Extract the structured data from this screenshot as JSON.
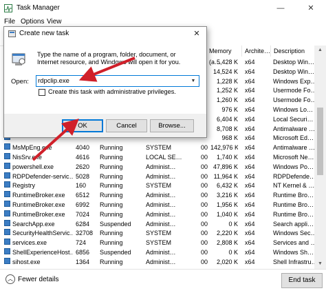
{
  "window": {
    "title": "Task Manager",
    "minimize": "—",
    "close": "✕"
  },
  "menu": [
    "File",
    "Options",
    "View"
  ],
  "columns": {
    "memory": "Memory (a…",
    "arch": "Archite…",
    "description": "Description"
  },
  "rows": [
    {
      "name": "",
      "pid": "",
      "status": "",
      "user": "",
      "cpu": "",
      "mem": "5,428 K",
      "arch": "x64",
      "desc": "Desktop Win…"
    },
    {
      "name": "",
      "pid": "",
      "status": "",
      "user": "",
      "cpu": "",
      "mem": "14,524 K",
      "arch": "x64",
      "desc": "Desktop Win…"
    },
    {
      "name": "",
      "pid": "",
      "status": "",
      "user": "",
      "cpu": "",
      "mem": "1,228 K",
      "arch": "x64",
      "desc": "Windows Exp…"
    },
    {
      "name": "",
      "pid": "",
      "status": "",
      "user": "",
      "cpu": "",
      "mem": "1,252 K",
      "arch": "x64",
      "desc": "Usermode Fo…"
    },
    {
      "name": "",
      "pid": "",
      "status": "",
      "user": "",
      "cpu": "",
      "mem": "1,260 K",
      "arch": "x64",
      "desc": "Usermode Fo…"
    },
    {
      "name": "",
      "pid": "",
      "status": "",
      "user": "",
      "cpu": "",
      "mem": "976 K",
      "arch": "x64",
      "desc": "Windows Lo…"
    },
    {
      "name": "",
      "pid": "",
      "status": "",
      "user": "",
      "cpu": "",
      "mem": "6,404 K",
      "arch": "x64",
      "desc": "Local Securi…"
    },
    {
      "name": "",
      "pid": "",
      "status": "",
      "user": "",
      "cpu": "",
      "mem": "8,708 K",
      "arch": "x64",
      "desc": "Antimalware …"
    },
    {
      "name": "",
      "pid": "",
      "status": "",
      "user": "",
      "cpu": "",
      "mem": "968 K",
      "arch": "x64",
      "desc": "Microsoft Ed…"
    },
    {
      "name": "MsMpEng.exe",
      "pid": "4040",
      "status": "Running",
      "user": "SYSTEM",
      "cpu": "00",
      "mem": "142,976 K",
      "arch": "x64",
      "desc": "Antimalware …"
    },
    {
      "name": "NisSrv.exe",
      "pid": "4616",
      "status": "Running",
      "user": "LOCAL SE…",
      "cpu": "00",
      "mem": "1,740 K",
      "arch": "x64",
      "desc": "Microsoft Ne…"
    },
    {
      "name": "powershell.exe",
      "pid": "2620",
      "status": "Running",
      "user": "Administ…",
      "cpu": "00",
      "mem": "47,896 K",
      "arch": "x64",
      "desc": "Windows Po…"
    },
    {
      "name": "RDPDefender-servic…",
      "pid": "5028",
      "status": "Running",
      "user": "Administ…",
      "cpu": "00",
      "mem": "11,964 K",
      "arch": "x64",
      "desc": "RDPDefende…"
    },
    {
      "name": "Registry",
      "pid": "160",
      "status": "Running",
      "user": "SYSTEM",
      "cpu": "00",
      "mem": "6,432 K",
      "arch": "x64",
      "desc": "NT Kernel & …"
    },
    {
      "name": "RuntimeBroker.exe",
      "pid": "6512",
      "status": "Running",
      "user": "Administ…",
      "cpu": "00",
      "mem": "3,216 K",
      "arch": "x64",
      "desc": "Runtime Bro…"
    },
    {
      "name": "RuntimeBroker.exe",
      "pid": "6992",
      "status": "Running",
      "user": "Administ…",
      "cpu": "00",
      "mem": "1,956 K",
      "arch": "x64",
      "desc": "Runtime Bro…"
    },
    {
      "name": "RuntimeBroker.exe",
      "pid": "7024",
      "status": "Running",
      "user": "Administ…",
      "cpu": "00",
      "mem": "1,040 K",
      "arch": "x64",
      "desc": "Runtime Bro…"
    },
    {
      "name": "SearchApp.exe",
      "pid": "6284",
      "status": "Suspended",
      "user": "Administ…",
      "cpu": "00",
      "mem": "0 K",
      "arch": "x64",
      "desc": "Search appli…"
    },
    {
      "name": "SecurityHealthServic…",
      "pid": "32708",
      "status": "Running",
      "user": "SYSTEM",
      "cpu": "00",
      "mem": "2,220 K",
      "arch": "x64",
      "desc": "Windows Sec…"
    },
    {
      "name": "services.exe",
      "pid": "724",
      "status": "Running",
      "user": "SYSTEM",
      "cpu": "00",
      "mem": "2,808 K",
      "arch": "x64",
      "desc": "Services and …"
    },
    {
      "name": "ShellExperienceHost…",
      "pid": "6856",
      "status": "Suspended",
      "user": "Administ…",
      "cpu": "00",
      "mem": "0 K",
      "arch": "x64",
      "desc": "Windows Sh…"
    },
    {
      "name": "sihost.exe",
      "pid": "1364",
      "status": "Running",
      "user": "Administ…",
      "cpu": "00",
      "mem": "2,020 K",
      "arch": "x64",
      "desc": "Shell Infrastru…"
    }
  ],
  "footer": {
    "fewer_details": "Fewer details",
    "end_task": "End task"
  },
  "dialog": {
    "title": "Create new task",
    "close": "✕",
    "description": "Type the name of a program, folder, document, or Internet resource, and Windows will open it for you.",
    "open_label": "Open:",
    "open_value": "rdpclip.exe",
    "admin_label": "Create this task with administrative privileges.",
    "ok": "OK",
    "cancel": "Cancel",
    "browse": "Browse..."
  },
  "colors": {
    "accent": "#0078d7",
    "annotation_arrow": "#d0202a"
  }
}
